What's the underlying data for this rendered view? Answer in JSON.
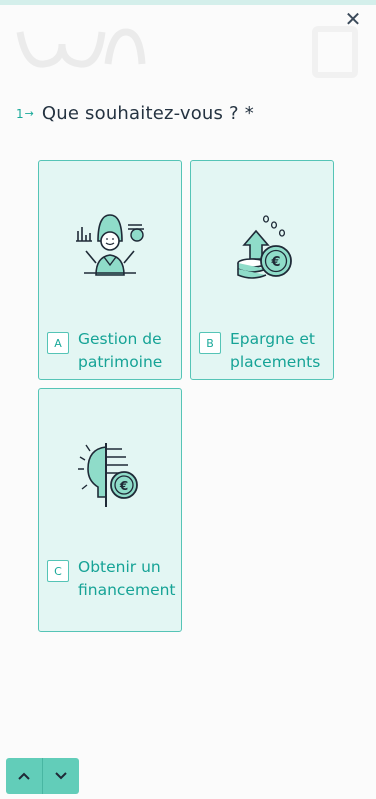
{
  "window": {
    "close_glyph": "✕"
  },
  "question": {
    "number": "1",
    "arrow": "→",
    "text": "Que souhaitez-vous ? *"
  },
  "choices": [
    {
      "key": "A",
      "label": "Gestion de patrimoine",
      "icon": "wealth-manager-icon"
    },
    {
      "key": "B",
      "label": "Epargne et placements",
      "icon": "savings-growth-icon"
    },
    {
      "key": "C",
      "label": "Obtenir un financement",
      "icon": "financing-idea-icon"
    }
  ],
  "navigation": {
    "up_icon": "chevron-up-icon",
    "down_icon": "chevron-down-icon"
  },
  "colors": {
    "accent": "#1aa99a",
    "choice_bg": "#e3f6f3",
    "choice_border": "#55c4b6",
    "nav_bg": "#62cdb9",
    "text": "#253341"
  }
}
